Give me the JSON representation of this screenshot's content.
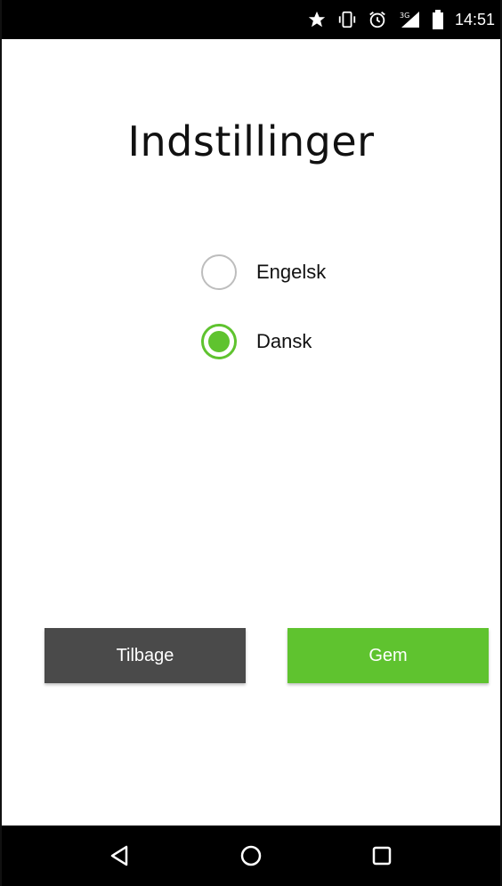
{
  "status_bar": {
    "time": "14:51",
    "icons": [
      "star-icon",
      "vibrate-icon",
      "alarm-icon",
      "signal-3g-icon",
      "battery-icon"
    ]
  },
  "screen": {
    "title": "Indstillinger"
  },
  "language_options": [
    {
      "label": "Engelsk",
      "checked": false
    },
    {
      "label": "Dansk",
      "checked": true
    }
  ],
  "buttons": {
    "back_label": "Tilbage",
    "save_label": "Gem"
  },
  "colors": {
    "accent": "#5fc32f",
    "back_button": "#4a4a4a",
    "bars": "#000000"
  },
  "nav_bar": {
    "icons": [
      "back-triangle-icon",
      "home-circle-icon",
      "recents-square-icon"
    ]
  }
}
